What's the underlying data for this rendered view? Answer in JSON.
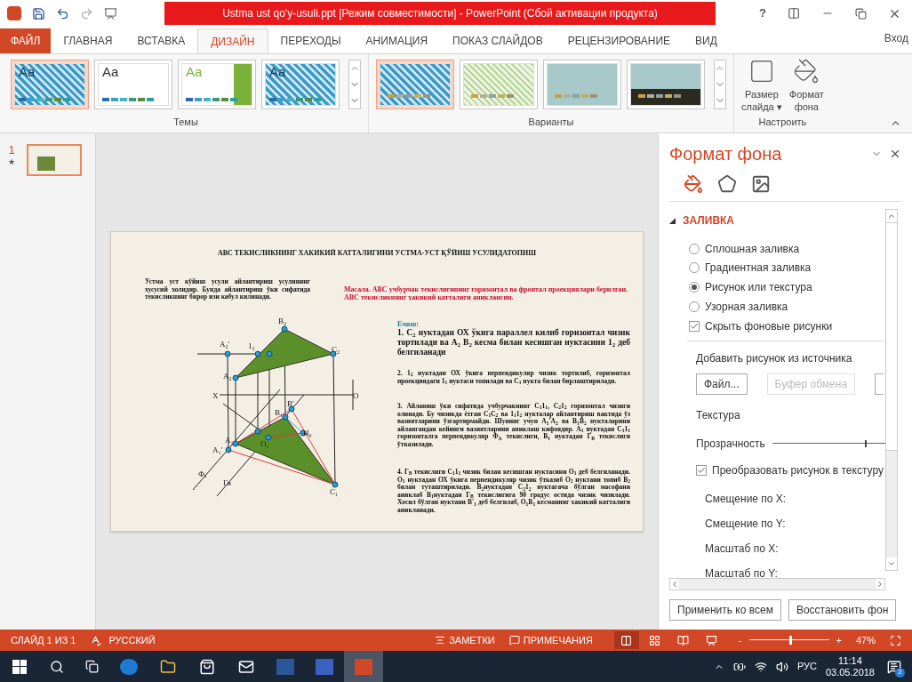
{
  "title_bar": {
    "title": "Ustma ust qo'y-usuli.ppt [Режим совместимости] -  PowerPoint (Сбой активации продукта)",
    "help": "?"
  },
  "tabs": [
    {
      "label": "ФАЙЛ",
      "kind": "file",
      "selected": false
    },
    {
      "label": "ГЛАВНАЯ",
      "kind": "tab",
      "selected": false
    },
    {
      "label": "ВСТАВКА",
      "kind": "tab",
      "selected": false
    },
    {
      "label": "ДИЗАЙН",
      "kind": "tab",
      "selected": true
    },
    {
      "label": "ПЕРЕХОДЫ",
      "kind": "tab",
      "selected": false
    },
    {
      "label": "АНИМАЦИЯ",
      "kind": "tab",
      "selected": false
    },
    {
      "label": "ПОКАЗ СЛАЙДОВ",
      "kind": "tab",
      "selected": false
    },
    {
      "label": "РЕЦЕНЗИРОВАНИЕ",
      "kind": "tab",
      "selected": false
    },
    {
      "label": "ВИД",
      "kind": "tab",
      "selected": false
    }
  ],
  "sign_in": "Вход",
  "ribbon": {
    "themes": {
      "label": "Темы",
      "items": [
        {
          "kind": "pattern",
          "text": "Aa",
          "selected": true
        },
        {
          "kind": "plain",
          "text": "Aa",
          "selected": false
        },
        {
          "kind": "green",
          "text": "Aa",
          "selected": false
        },
        {
          "kind": "pattern",
          "text": "Aa",
          "selected": false
        }
      ]
    },
    "variants": {
      "label": "Варианты",
      "items": [
        {
          "kind": "pattern",
          "selected": true
        },
        {
          "kind": "light",
          "selected": false
        },
        {
          "kind": "teal",
          "selected": false
        },
        {
          "kind": "dark",
          "selected": false
        }
      ]
    },
    "customize": {
      "label": "Настроить",
      "buttons": [
        {
          "kind": "size",
          "line1": "Размер",
          "line2": "слайда ▾"
        },
        {
          "kind": "format",
          "line1": "Формат",
          "line2": "фона"
        }
      ]
    }
  },
  "thumbnails": [
    {
      "number": "1",
      "mark": "★",
      "selected": true
    }
  ],
  "slide": {
    "title": "АВС ТЕКИСЛИКНИНГ ХАКИКИЙ КАТТАЛИГИНИ УСТМА-УСТ ҚЎЙИШ УСУЛИДАТОПИШ",
    "intro": "Устма уст кўйиш усули айлантириш усулининг хусусий холидир. Бунда айлантириш ўки сифатида текисликнинг бирор изи кабул килинади.",
    "problem": "Масала. АВС учбурчак текислигининг горизонтал ва фронтал проекциялари берилган. АВС текисликнинг хакикий катталиги аниклансин.",
    "solution_label": "Ечиш:",
    "steps": [
      "1. С$_{2}$ нуктадан ОХ ўкига параллел килиб горизонтал чизик тортилади ва А$_{2}$ В$_{2}$  кесма билан кесишган нуктасини 1$_{2}$ деб белгиланади",
      "2. 1$_{2}$ нуктадан ОХ ўкига перпендикуляр чизик тортилиб, горизонтал проекциядаги 1$_{1}$ нуктаси топилади ва С$_{1}$ нукта билан бирлаштирилади.",
      "3. Айланиш ўки сифатида учбурчакнинг С$_{1}$1$_{1}$, С$_{2}$1$_{2}$ горизонтал чизиги олинади. Бу чизикда ётган С$_{1}$С$_{2}$ ва 1$_{1}$1$_{2}$ нукталар айлантириш вактида ўз вазиятларини ўзгартирмайди. Шунинг учун А$_{1}$'А$_{2}$ ва В$_{1}$В$_{2}$ нукталарини айлангандан кейинги вазиятларини аниклаш кифоядир. А$_{1}$ нуктадан С$_{1}$1$_{1}$ горизонталга перпендикуляр Ф$_{А}$ текислиги, В$_{1}$ нуктадан Г$_{В}$ текислиги ўтказилади.",
      "4. Г$_{В}$ текислиги С$_{1}$1$_{1}$ чизик билан кесишган нуктасини О$_{1}$ деб белгиланади. О$_{1}$ нуктадан ОХ ўкига перпендикуляр чизик ўтказиб О$_{2}$ нуктани топиб В$_{2}$ билан туташтирилади. В$_{2}$нуктадан С$_{2}$1$_{2}$ нуктагача бўлган масофани аниклаб В$_{1}$нуктадан Г$_{В}$ текислигига 90 градус остида чизик чизилади. Хосил бўлган нуктани В'$_{1}$ деб белгилаб, О$_{1}$В$_{1}$ кесманинг хакикий катталиги аникланади."
    ],
    "drawing_labels": [
      "B₂",
      "A₂'",
      "1₂",
      "C₂",
      "A₂",
      "X",
      "O",
      "B'",
      "B₁",
      "A₁",
      "O₁",
      "H₀",
      "A₁'",
      "C₁",
      "Фₐ",
      "Гв"
    ]
  },
  "format_pane": {
    "title": "Формат фона",
    "section": "ЗАЛИВКА",
    "expanded": true,
    "fills": [
      {
        "label": "Сплошная заливка",
        "selected": false
      },
      {
        "label": "Градиентная заливка",
        "selected": false
      },
      {
        "label": "Рисунок или текстура",
        "selected": true
      },
      {
        "label": "Узорная заливка",
        "selected": false
      }
    ],
    "hide_graphics": {
      "label": "Скрыть фоновые рисунки",
      "checked": true
    },
    "insert_label": "Добавить рисунок из источника",
    "source_buttons": [
      {
        "label": "Файл...",
        "disabled": false
      },
      {
        "label": "Буфер обмена",
        "disabled": true
      }
    ],
    "texture": "Текстура",
    "transparency": {
      "label": "Прозрачность",
      "level": 0.82
    },
    "tile": {
      "label": "Преобразовать рисунок в текстуру",
      "checked": true
    },
    "fields": [
      "Смещение по X:",
      "Смещение по Y:",
      "Масштаб по X:",
      "Масштаб по Y:"
    ],
    "buttons": [
      "Применить ко всем",
      "Восстановить фон"
    ]
  },
  "status_bar": {
    "slide": "СЛАЙД 1 ИЗ 1",
    "language": "РУССКИЙ",
    "notes": "ЗАМЕТКИ",
    "comments": "ПРИМЕЧАНИЯ",
    "views": [
      {
        "kind": "normal",
        "selected": true
      },
      {
        "kind": "sorter",
        "selected": false
      },
      {
        "kind": "reading",
        "selected": false
      },
      {
        "kind": "show",
        "selected": false
      }
    ],
    "zoom": {
      "level": 0.5,
      "reading": "47%"
    },
    "zoom_minus": "-",
    "zoom_plus": "+"
  },
  "taskbar": {
    "apps": [
      {
        "kind": "edge",
        "active": false
      },
      {
        "kind": "explorer",
        "active": false
      },
      {
        "kind": "store",
        "active": false
      },
      {
        "kind": "mail",
        "active": false
      },
      {
        "kind": "word",
        "active": false
      },
      {
        "kind": "app",
        "active": false
      },
      {
        "kind": "powerpoint",
        "active": true
      }
    ],
    "language": "РУС",
    "time": "11:14",
    "date": "03.05.2018",
    "notifications": "2"
  }
}
